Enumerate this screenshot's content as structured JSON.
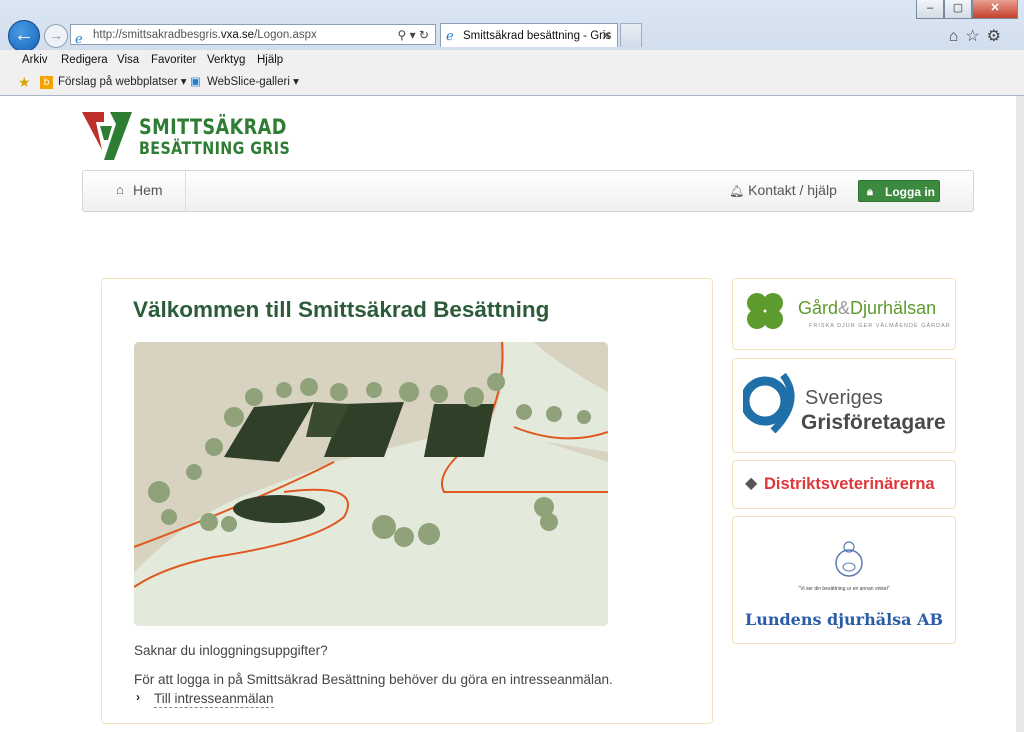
{
  "browser": {
    "url_prefix": "http://smittsakradbesgris.",
    "url_domain": "vxa.se",
    "url_path": "/Logon.aspx",
    "tab_title": "Smittsäkrad besättning - Gris",
    "menu": [
      "Arkiv",
      "Redigera",
      "Visa",
      "Favoriter",
      "Verktyg",
      "Hjälp"
    ],
    "favorites": [
      "Förslag på webbplatser ▾",
      "WebSlice-galleri ▾"
    ]
  },
  "site": {
    "logo_line1": "SMITTSÄKRAD",
    "logo_line2": "BESÄTTNING GRIS",
    "nav": {
      "home": "Hem",
      "contact": "Kontakt / hjälp",
      "login": "Logga in"
    },
    "main": {
      "heading": "Välkommen till Smittsäkrad Besättning",
      "question": "Saknar du inloggningsuppgifter?",
      "info": "För att logga in på Smittsäkrad Besättning behöver du göra en intresseanmälan.",
      "link": "Till intresseanmälan"
    },
    "partners": {
      "gd_name_1": "Gård",
      "gd_amp": "&",
      "gd_name_2": "Djurhälsan",
      "gd_tagline": "FRISKA DJUR GER VÄLMÅENDE GÅRDAR",
      "sg_line1": "Sveriges",
      "sg_line2": "Grisföretagare",
      "dv_name": "Distriktsveterinärerna",
      "ld_motto": "\"Vi ser din besättning ur en annan vinkel\"",
      "ld_name": "Lundens djurhälsa AB"
    }
  },
  "colors": {
    "brand_green": "#2e7d33",
    "heading_green": "#2c5b3a",
    "button_green": "#3c8a3f",
    "logo_red": "#c0302a",
    "dv_red": "#e0373b",
    "sg_blue": "#1f6fa8"
  }
}
